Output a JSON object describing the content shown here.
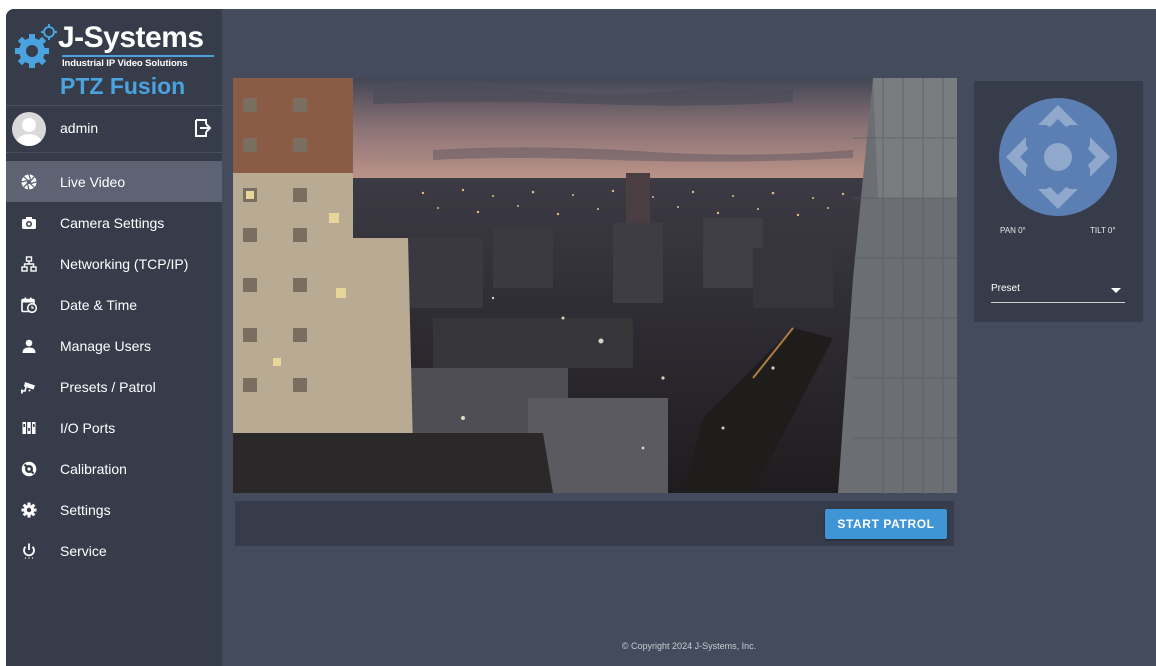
{
  "brand": {
    "name": "J-Systems",
    "tagline": "Industrial IP Video Solutions",
    "product": "PTZ Fusion",
    "accent_color": "#4aa3df"
  },
  "user": {
    "name": "admin",
    "avatar_icon": "user-avatar-icon",
    "logout_icon": "logout-icon"
  },
  "nav": {
    "active": "Live Video",
    "items": [
      {
        "label": "Live Video",
        "icon": "aperture-icon"
      },
      {
        "label": "Camera Settings",
        "icon": "camera-icon"
      },
      {
        "label": "Networking (TCP/IP)",
        "icon": "network-icon"
      },
      {
        "label": "Date & Time",
        "icon": "calendar-clock-icon"
      },
      {
        "label": "Manage Users",
        "icon": "user-icon"
      },
      {
        "label": "Presets / Patrol",
        "icon": "security-camera-icon"
      },
      {
        "label": "I/O Ports",
        "icon": "io-ports-icon"
      },
      {
        "label": "Calibration",
        "icon": "calibration-icon"
      },
      {
        "label": "Settings",
        "icon": "gear-icon"
      },
      {
        "label": "Service",
        "icon": "power-icon"
      }
    ]
  },
  "video": {
    "content": "night-city-live-feed"
  },
  "patrol": {
    "start_label": "START PATROL",
    "button_color": "#3f95d6"
  },
  "ptz": {
    "pan_label": "PAN 0°",
    "tilt_label": "TILT 0°",
    "preset_value": "Preset"
  },
  "footer": {
    "copyright": "© Copyright 2024 J-Systems, Inc."
  },
  "colors": {
    "sidebar_bg": "#363c4a",
    "main_bg": "#444b5c",
    "active_nav_bg": "#5d6373",
    "joystick_color": "#5b7fb3"
  }
}
